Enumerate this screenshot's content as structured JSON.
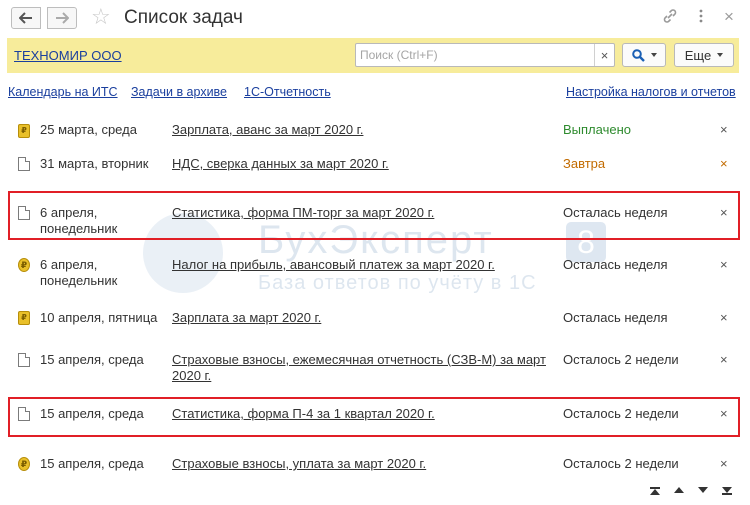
{
  "window": {
    "title": "Список задач",
    "back_icon": "arrow-left-icon",
    "forward_icon": "arrow-right-icon",
    "favorite_icon": "star-icon",
    "link_icon": "chain-link-icon",
    "menu_icon": "vertical-dots-icon",
    "close_label": "×"
  },
  "toolbar": {
    "organization": "ТЕХНОМИР ООО",
    "search_placeholder": "Поиск (Ctrl+F)",
    "search_clear": "×",
    "find_icon": "magnifier-icon",
    "more_label": "Еще"
  },
  "links": {
    "calendar": "Календарь на ИТС",
    "archive": "Задачи в архиве",
    "reporting": "1С-Отчетность",
    "settings": "Настройка налогов и отчетов"
  },
  "colors": {
    "toolbar_bg": "#f7ec9b",
    "link": "#1a3f9e",
    "paid": "#2e8b2e",
    "tomorrow": "#c26b00",
    "highlight": "#e11f26"
  },
  "tasks": [
    {
      "icon": "coin-stack-icon",
      "date": "25 марта, среда",
      "name": "Зарплата, аванс за март 2020 г.",
      "status": "Выплачено",
      "status_color": "#2e8b2e",
      "close": "×"
    },
    {
      "icon": "document-icon",
      "date": "31 марта, вторник",
      "name": "НДС, сверка данных за март 2020 г.",
      "status": "Завтра",
      "status_color": "#c26b00",
      "close": "×"
    },
    {
      "icon": "document-icon",
      "date": "6 апреля, понедельник",
      "name": "Статистика, форма ПМ-торг за март 2020 г.",
      "status": "Осталась неделя",
      "status_color": "#333333",
      "close": "×"
    },
    {
      "icon": "coin-icon",
      "date": "6 апреля, понедельник",
      "name": "Налог на прибыль, авансовый платеж за март 2020 г.",
      "status": "Осталась неделя",
      "status_color": "#333333",
      "close": "×"
    },
    {
      "icon": "coin-stack-icon",
      "date": "10 апреля, пятница",
      "name": "Зарплата за март 2020 г.",
      "status": "Осталась неделя",
      "status_color": "#333333",
      "close": "×"
    },
    {
      "icon": "document-icon",
      "date": "15 апреля, среда",
      "name": "Страховые взносы, ежемесячная отчетность (СЗВ-М) за март 2020 г.",
      "status": "Осталось 2 недели",
      "status_color": "#333333",
      "close": "×"
    },
    {
      "icon": "document-icon",
      "date": "15 апреля, среда",
      "name": "Статистика, форма П-4 за 1 квартал 2020 г.",
      "status": "Осталось 2 недели",
      "status_color": "#333333",
      "close": "×"
    },
    {
      "icon": "coin-icon",
      "date": "15 апреля, среда",
      "name": "Страховые взносы, уплата за март 2020 г.",
      "status": "Осталось 2 недели",
      "status_color": "#333333",
      "close": "×"
    }
  ],
  "watermark": {
    "title": "БухЭксперт",
    "number": "8",
    "subtitle": "База ответов по учёту в 1С"
  }
}
